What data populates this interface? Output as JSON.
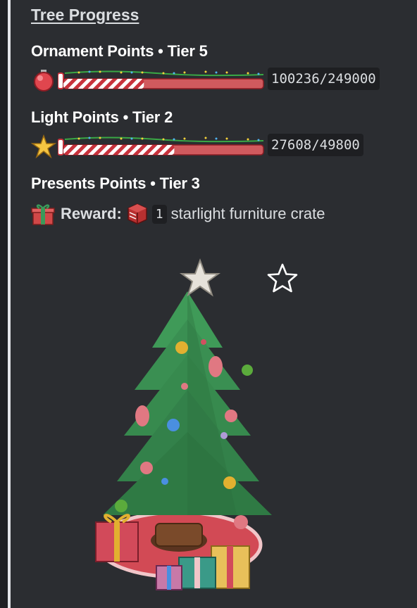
{
  "embed": {
    "title": "Tree Progress",
    "ornament": {
      "heading": "Ornament Points • Tier 5",
      "counter": "100236/249000",
      "progress": 0.4026,
      "icon": "ornament-icon"
    },
    "light": {
      "heading": "Light Points • Tier 2",
      "counter": "27608/49800",
      "progress": 0.5544,
      "icon": "star-icon"
    },
    "presents": {
      "heading": "Presents Points • Tier 3",
      "reward_label": "Reward:",
      "reward_qty": "1",
      "reward_item": "starlight furniture crate",
      "icon": "gift-icon",
      "item_icon": "crate-icon"
    },
    "image": {
      "icon": "christmas-tree-image"
    },
    "favorite": {
      "icon": "star-outline-icon"
    }
  },
  "colors": {
    "background": "#2b2d31",
    "accent_bar": "#e3e5e8",
    "code_bg": "#1e1f22",
    "bar_red": "#c8323c",
    "bar_stripe": "#ffffff",
    "bar_empty": "#d05a5e"
  }
}
